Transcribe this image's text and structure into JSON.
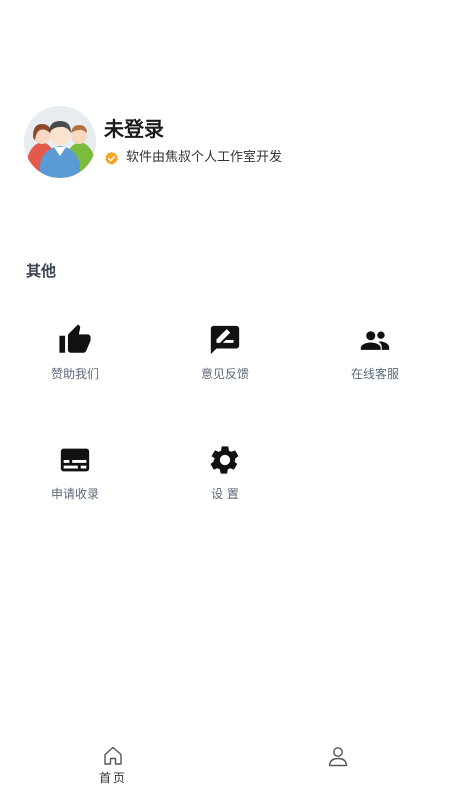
{
  "profile": {
    "name": "未登录",
    "description": "软件由焦叔个人工作室开发",
    "badge_color": "#f5a623"
  },
  "section": {
    "title": "其他"
  },
  "menu": [
    {
      "label": "赞助我们",
      "icon": "thumbs-up-icon"
    },
    {
      "label": "意见反馈",
      "icon": "feedback-icon"
    },
    {
      "label": "在线客服",
      "icon": "people-icon"
    },
    {
      "label": "申请收录",
      "icon": "subtitles-icon"
    },
    {
      "label": "设 置",
      "icon": "gear-icon"
    }
  ],
  "bottom_nav": [
    {
      "label": "首页",
      "icon": "home-icon"
    },
    {
      "label": "",
      "icon": "user-icon"
    }
  ]
}
